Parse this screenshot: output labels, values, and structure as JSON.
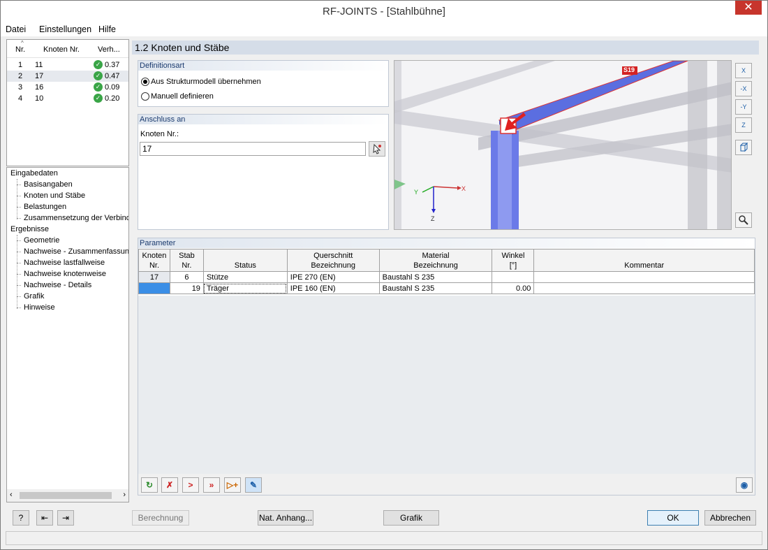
{
  "window": {
    "title": "RF-JOINTS - [Stahlbühne]",
    "close": "✕"
  },
  "menu": [
    "Datei",
    "Einstellungen",
    "Hilfe"
  ],
  "nodes_table": {
    "columns": [
      "Nr.",
      "Knoten Nr.",
      "Verh..."
    ],
    "rows": [
      {
        "nr": "1",
        "knoten": "11",
        "ratio": "0.37"
      },
      {
        "nr": "2",
        "knoten": "17",
        "ratio": "0.47"
      },
      {
        "nr": "3",
        "knoten": "16",
        "ratio": "0.09"
      },
      {
        "nr": "4",
        "knoten": "10",
        "ratio": "0.20"
      }
    ]
  },
  "nav": {
    "eingabe": "Eingabedaten",
    "eingabe_items": [
      "Basisangaben",
      "Knoten und Stäbe",
      "Belastungen",
      "Zusammensetzung der Verbindung"
    ],
    "ergebnisse": "Ergebnisse",
    "ergebnisse_items": [
      "Geometrie",
      "Nachweise - Zusammenfassung",
      "Nachweise lastfallweise",
      "Nachweise knotenweise",
      "Nachweise - Details",
      "Grafik",
      "Hinweise"
    ]
  },
  "main": {
    "title": "1.2 Knoten und Stäbe",
    "definitionsart": {
      "label": "Definitionsart",
      "option1": "Aus Strukturmodell übernehmen",
      "option2": "Manuell definieren",
      "selected": "option1"
    },
    "anschluss": {
      "label": "Anschluss an",
      "field_label": "Knoten Nr.:",
      "value": "17"
    },
    "view": {
      "member_label": "S19",
      "axis_x": "X",
      "axis_y": "Y",
      "axis_z": "Z",
      "buttons": [
        "X",
        "-X",
        "-Y",
        "Z"
      ]
    },
    "parameter": {
      "label": "Parameter",
      "headers": [
        [
          "Knoten",
          "Nr."
        ],
        [
          "Stab",
          "Nr."
        ],
        [
          "",
          "Status"
        ],
        [
          "Querschnitt",
          "Bezeichnung"
        ],
        [
          "Material",
          "Bezeichnung"
        ],
        [
          "Winkel",
          "[°]"
        ],
        [
          "",
          "Kommentar"
        ]
      ],
      "rows": [
        {
          "knoten": "17",
          "stab": "6",
          "status": "Stütze",
          "querschnitt": "IPE 270 (EN)",
          "material": "Baustahl S 235",
          "winkel": "",
          "kommentar": ""
        },
        {
          "knoten": "",
          "stab": "19",
          "status": "Träger",
          "querschnitt": "IPE 160 (EN)",
          "material": "Baustahl S 235",
          "winkel": "0.00",
          "kommentar": ""
        }
      ]
    }
  },
  "footer": {
    "berechnung": "Berechnung",
    "nat_anhang": "Nat. Anhang...",
    "grafik": "Grafik",
    "ok": "OK",
    "abbrechen": "Abbrechen"
  },
  "colors": {
    "accent": "#1d5fa8",
    "member_highlight": "#5b6ee0",
    "check": "#3aa547",
    "close": "#c7352c"
  }
}
